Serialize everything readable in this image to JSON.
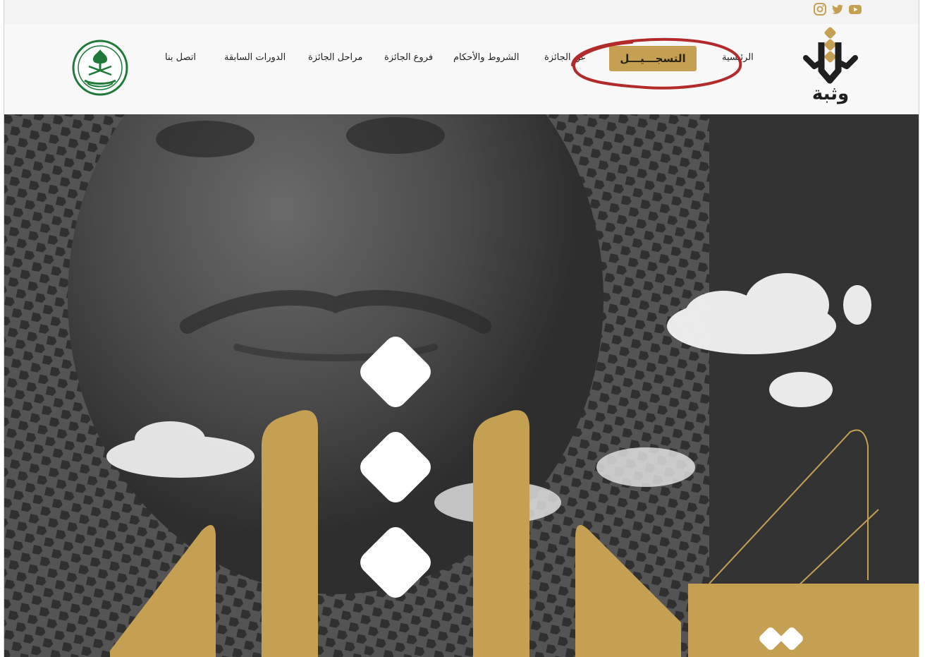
{
  "social": {
    "icons": [
      "instagram-icon",
      "twitter-icon",
      "youtube-icon"
    ],
    "colors": {
      "social": "#c6a052"
    }
  },
  "brand": {
    "wordmark": "وثبة"
  },
  "nav": {
    "home": "الرئيسية",
    "register": "التسجـــيـــل",
    "about": "عن الجائزة",
    "terms": "الشروط والأحكام",
    "branches": "فروع الجائزة",
    "stages": "مراحل الجائزة",
    "previous": "الدورات السابقة",
    "contact": "اتصل بنا"
  },
  "colors": {
    "accent": "#c6a052",
    "navbar_bg": "#f8f8f8",
    "hero_bg": "#3a3a3a",
    "annotation": "#b22a2a",
    "ministry_green": "#1f7a3a"
  },
  "annotation": {
    "note": "red circle around the registration button"
  }
}
